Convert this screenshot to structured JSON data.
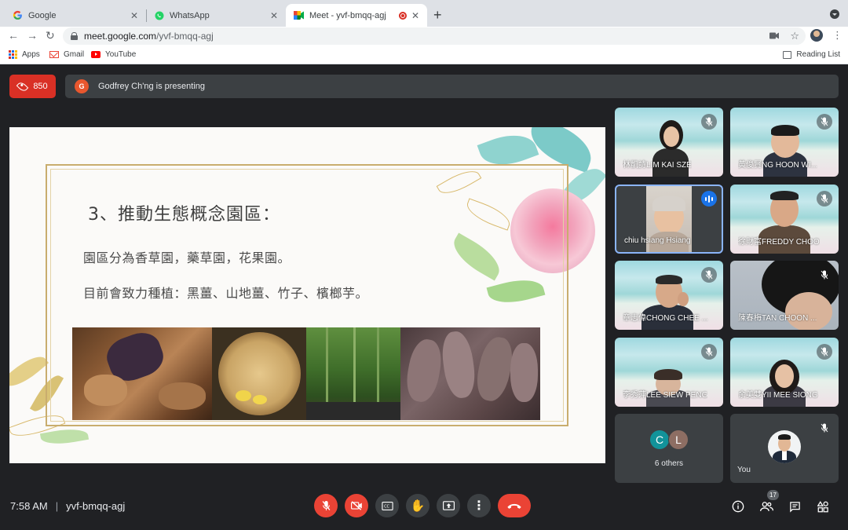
{
  "browser": {
    "tabs": [
      {
        "title": "Google",
        "icon": "google-icon"
      },
      {
        "title": "WhatsApp",
        "icon": "whatsapp-icon"
      },
      {
        "title": "Meet - yvf-bmqq-agj",
        "icon": "meet-icon",
        "recording": true
      }
    ],
    "url_host": "meet.google.com",
    "url_path": "/yvf-bmqq-agj",
    "bookmarks": [
      "Apps",
      "Gmail",
      "YouTube"
    ],
    "reading_list": "Reading List"
  },
  "meet": {
    "view_count": "850",
    "presenter_initial": "G",
    "presenting_text": "Godfrey Ch'ng is presenting",
    "slide": {
      "title": "3、推動生態概念園區：",
      "line1": "園區分為香草園，藥草園，花果園。",
      "line2": "目前會致力種植：黑薑、山地薑、竹子、檳榔芋。"
    },
    "participants": [
      {
        "name": "林凱詩LIM KAI SZE",
        "muted": true
      },
      {
        "name": "黃俊賢NG HOON WI...",
        "muted": true
      },
      {
        "name": "chiu hsiang Hsiang",
        "speaking": true
      },
      {
        "name": "徐財富FREDDY CHOO",
        "muted": true
      },
      {
        "name": "章志偉CHONG CHEE ...",
        "muted": true
      },
      {
        "name": "陳春梅TAN CHOON ...",
        "muted": true
      },
      {
        "name": "李秀萍LEE SIEW PENG",
        "muted": true
      },
      {
        "name": "余美雙YII MEE SIONG",
        "muted": true
      }
    ],
    "others": {
      "initials": [
        "C",
        "L"
      ],
      "label": "6 others"
    },
    "you_label": "You",
    "time": "7:58 AM",
    "meeting_code": "yvf-bmqq-agj",
    "participant_count": "17"
  },
  "colors": {
    "accent_red": "#ea4335",
    "speaking_blue": "#1a73e8",
    "tile_dark": "#3c4043",
    "bg": "#202124"
  }
}
